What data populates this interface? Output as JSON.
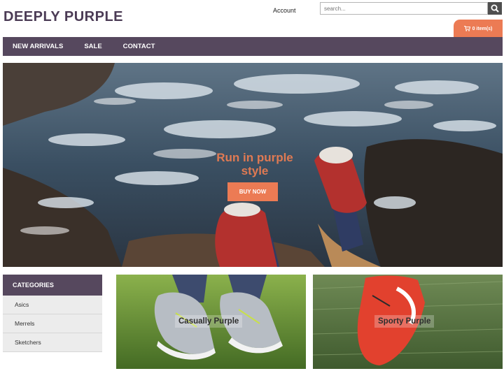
{
  "header": {
    "logo": "DEEPLY PURPLE",
    "account_label": "Account",
    "search_placeholder": "search...",
    "cart_label": "0 item(s)"
  },
  "icons": {
    "search": "search-icon",
    "cart": "cart-icon"
  },
  "nav": {
    "items": [
      "NEW ARRIVALS",
      "SALE",
      "CONTACT"
    ]
  },
  "hero": {
    "title_line1": "Run in purple",
    "title_line2": "style",
    "button_label": "BUY NOW"
  },
  "sidebar": {
    "title": "CATEGORIES",
    "items": [
      "Asics",
      "Merrels",
      "Sketchers"
    ]
  },
  "promos": [
    {
      "label": "Casually Purple"
    },
    {
      "label": "Sporty Purple"
    }
  ],
  "colors": {
    "accent": "#ec7b54",
    "nav": "#56485e",
    "logo": "#4b3b55"
  }
}
